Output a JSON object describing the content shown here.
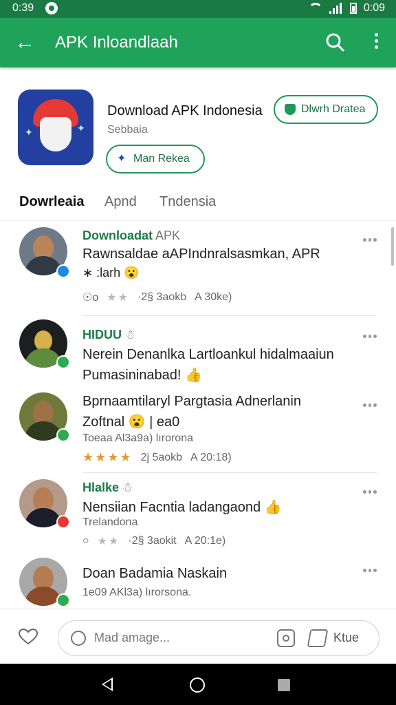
{
  "status_bar": {
    "time_left": "0:39",
    "time_right": "0:09"
  },
  "app_bar": {
    "title": "APK Inloandlaah"
  },
  "app": {
    "name": "Download APK Indonesia",
    "subtitle": "Sebbaia",
    "download_label": "Dlwrh Dratea",
    "rate_label": "Man Rekea"
  },
  "tabs": [
    "Dowrleaia",
    "Apnd",
    "Tndensia"
  ],
  "feed": [
    {
      "name": "Downloadat",
      "name_suffix": "APK",
      "text_lines": [
        "Rawnsaldae aAPIndnralsasmkan, APR",
        "∗ :larh 😮"
      ],
      "meta": "",
      "rating_stars": "★★",
      "rating_style": "gray",
      "rating_prefix": "☉o",
      "stat1": "·2§ 3aokb",
      "stat2": "A 30ke)",
      "badge_color": "#1e88e5",
      "avatar_bg": "#6f7a89",
      "shirt_color": "#2f3a45"
    },
    {
      "name": "HIDUU",
      "name_suffix": "☃",
      "text_lines": [
        "Nerein Denanlka Lartloankul hidalmaaiun",
        "Pumasininabad! 👍"
      ],
      "meta": "",
      "rating_stars": "",
      "rating_style": "none",
      "rating_prefix": "",
      "stat1": "",
      "stat2": "",
      "badge_color": "#2eaa52",
      "avatar_bg": "#1c1f1f",
      "shirt_color": "#5f8b3f"
    },
    {
      "name": "Bprnaamtilaryl Pargtasia Adnerlanin",
      "name_suffix": "",
      "text_lines": [
        "Zoftnal 😮 | ea0"
      ],
      "meta": "Toeaa Al3a9a) lırorona",
      "rating_stars": "★★★★",
      "rating_style": "gold",
      "rating_prefix": "",
      "stat1": "2j 5aokb",
      "stat2": "A 20:18)",
      "badge_color": "#2eaa52",
      "avatar_bg": "#6f7a3a",
      "shirt_color": "#2f3a1f"
    },
    {
      "name": "Hlalke",
      "name_suffix": "☃",
      "text_lines": [
        "Nensiian Facntia ladangaond 👍"
      ],
      "meta": "Trelandona",
      "rating_stars": "★★",
      "rating_style": "gray",
      "rating_prefix": "○",
      "stat1": "·2§ 3aokit",
      "stat2": "A 20:1e)",
      "badge_color": "#e53935",
      "avatar_bg": "#b39a8a",
      "shirt_color": "#1b1e2a"
    },
    {
      "name": "Doan Badamia Naskain",
      "name_suffix": "",
      "text_lines": [
        "1e09 AKl3a) lırorsona."
      ],
      "meta": "",
      "rating_stars": "",
      "rating_style": "none",
      "rating_prefix": "",
      "stat1": "",
      "stat2": "",
      "badge_color": "#2eaa52",
      "avatar_bg": "#a8a8a8",
      "shirt_color": "#8b4a2a"
    }
  ],
  "bottom_bar": {
    "placeholder": "Mad amage...",
    "send_label": "Ktue"
  },
  "colors": {
    "primary": "#1fa25a",
    "status_bar": "#1b7a43",
    "accent_text": "#1e7b46",
    "outline": "#1f9a55"
  }
}
